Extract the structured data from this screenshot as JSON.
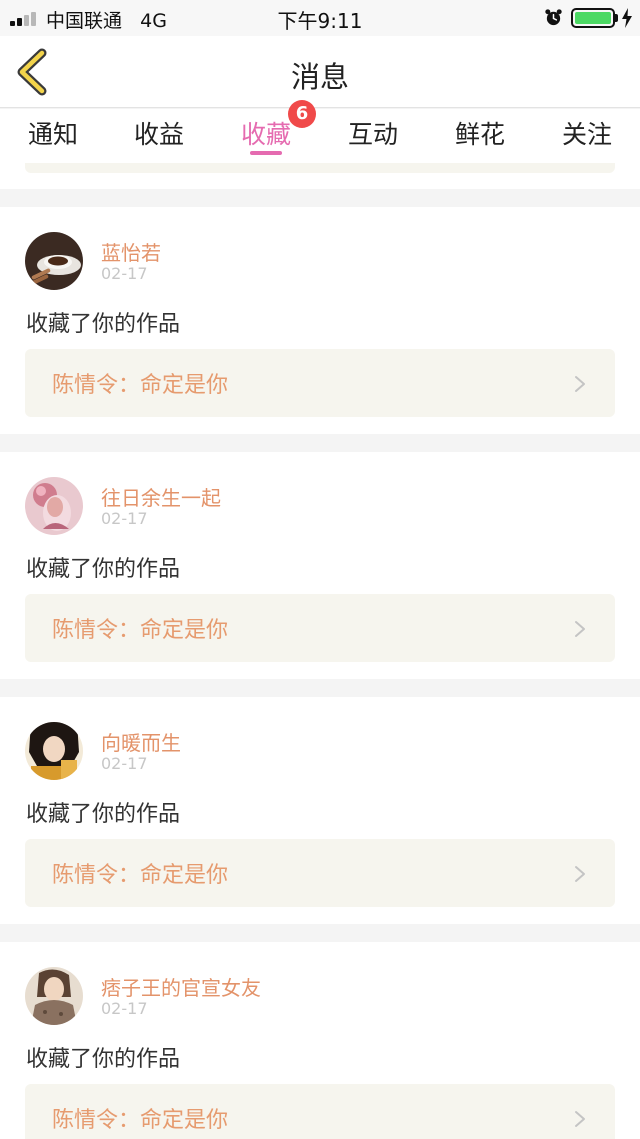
{
  "status_bar": {
    "carrier": "中国联通",
    "network": "4G",
    "time": "下午9:11",
    "battery_color": "#4cd964",
    "icons": [
      "signal-icon",
      "alarm-icon",
      "battery-icon",
      "charging-icon"
    ]
  },
  "nav": {
    "title": "消息",
    "back_icon": "chevron-left-icon"
  },
  "tabs": [
    {
      "label": "通知"
    },
    {
      "label": "收益"
    },
    {
      "label": "收藏"
    },
    {
      "label": "互动"
    },
    {
      "label": "鲜花"
    },
    {
      "label": "关注"
    }
  ],
  "active_tab": "收藏",
  "badge": {
    "count": "6",
    "color": "#f04a4a"
  },
  "accent_color": "#e56bb0",
  "notifications": [
    {
      "username": "蓝怡若",
      "date": "02-17",
      "action": "收藏了你的作品",
      "work_title": "陈情令：命定是你"
    },
    {
      "username": "往日余生一起",
      "date": "02-17",
      "action": "收藏了你的作品",
      "work_title": "陈情令：命定是你"
    },
    {
      "username": "向暖而生",
      "date": "02-17",
      "action": "收藏了你的作品",
      "work_title": "陈情令：命定是你"
    },
    {
      "username": "痞子王的官宣女友",
      "date": "02-17",
      "action": "收藏了你的作品",
      "work_title": "陈情令：命定是你"
    }
  ]
}
